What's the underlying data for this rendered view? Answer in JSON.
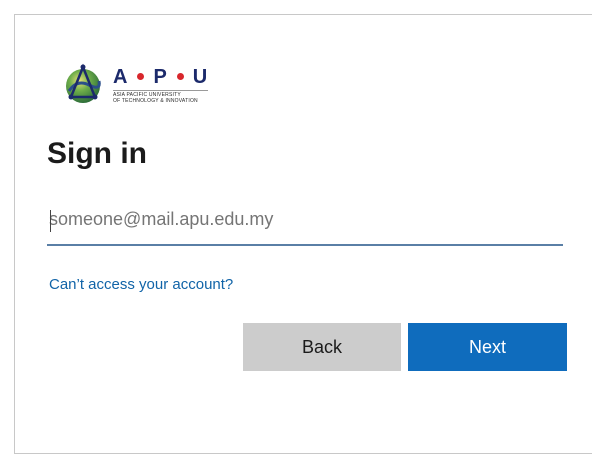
{
  "logo": {
    "letters": [
      "A",
      "P",
      "U"
    ],
    "tagline_line1": "ASIA PACIFIC UNIVERSITY",
    "tagline_line2": "OF TECHNOLOGY & INNOVATION",
    "globe_icon": "apu-globe-icon",
    "letter_color": "#1c2a6b",
    "dot_color": "#d8262c"
  },
  "signin": {
    "title": "Sign in",
    "email_placeholder": "someone@mail.apu.edu.my",
    "email_value": "",
    "cant_access_label": "Can’t access your account?",
    "back_label": "Back",
    "next_label": "Next"
  },
  "colors": {
    "accent": "#0f6cbd",
    "link": "#1164a8",
    "secondary_button": "#cccccc"
  }
}
